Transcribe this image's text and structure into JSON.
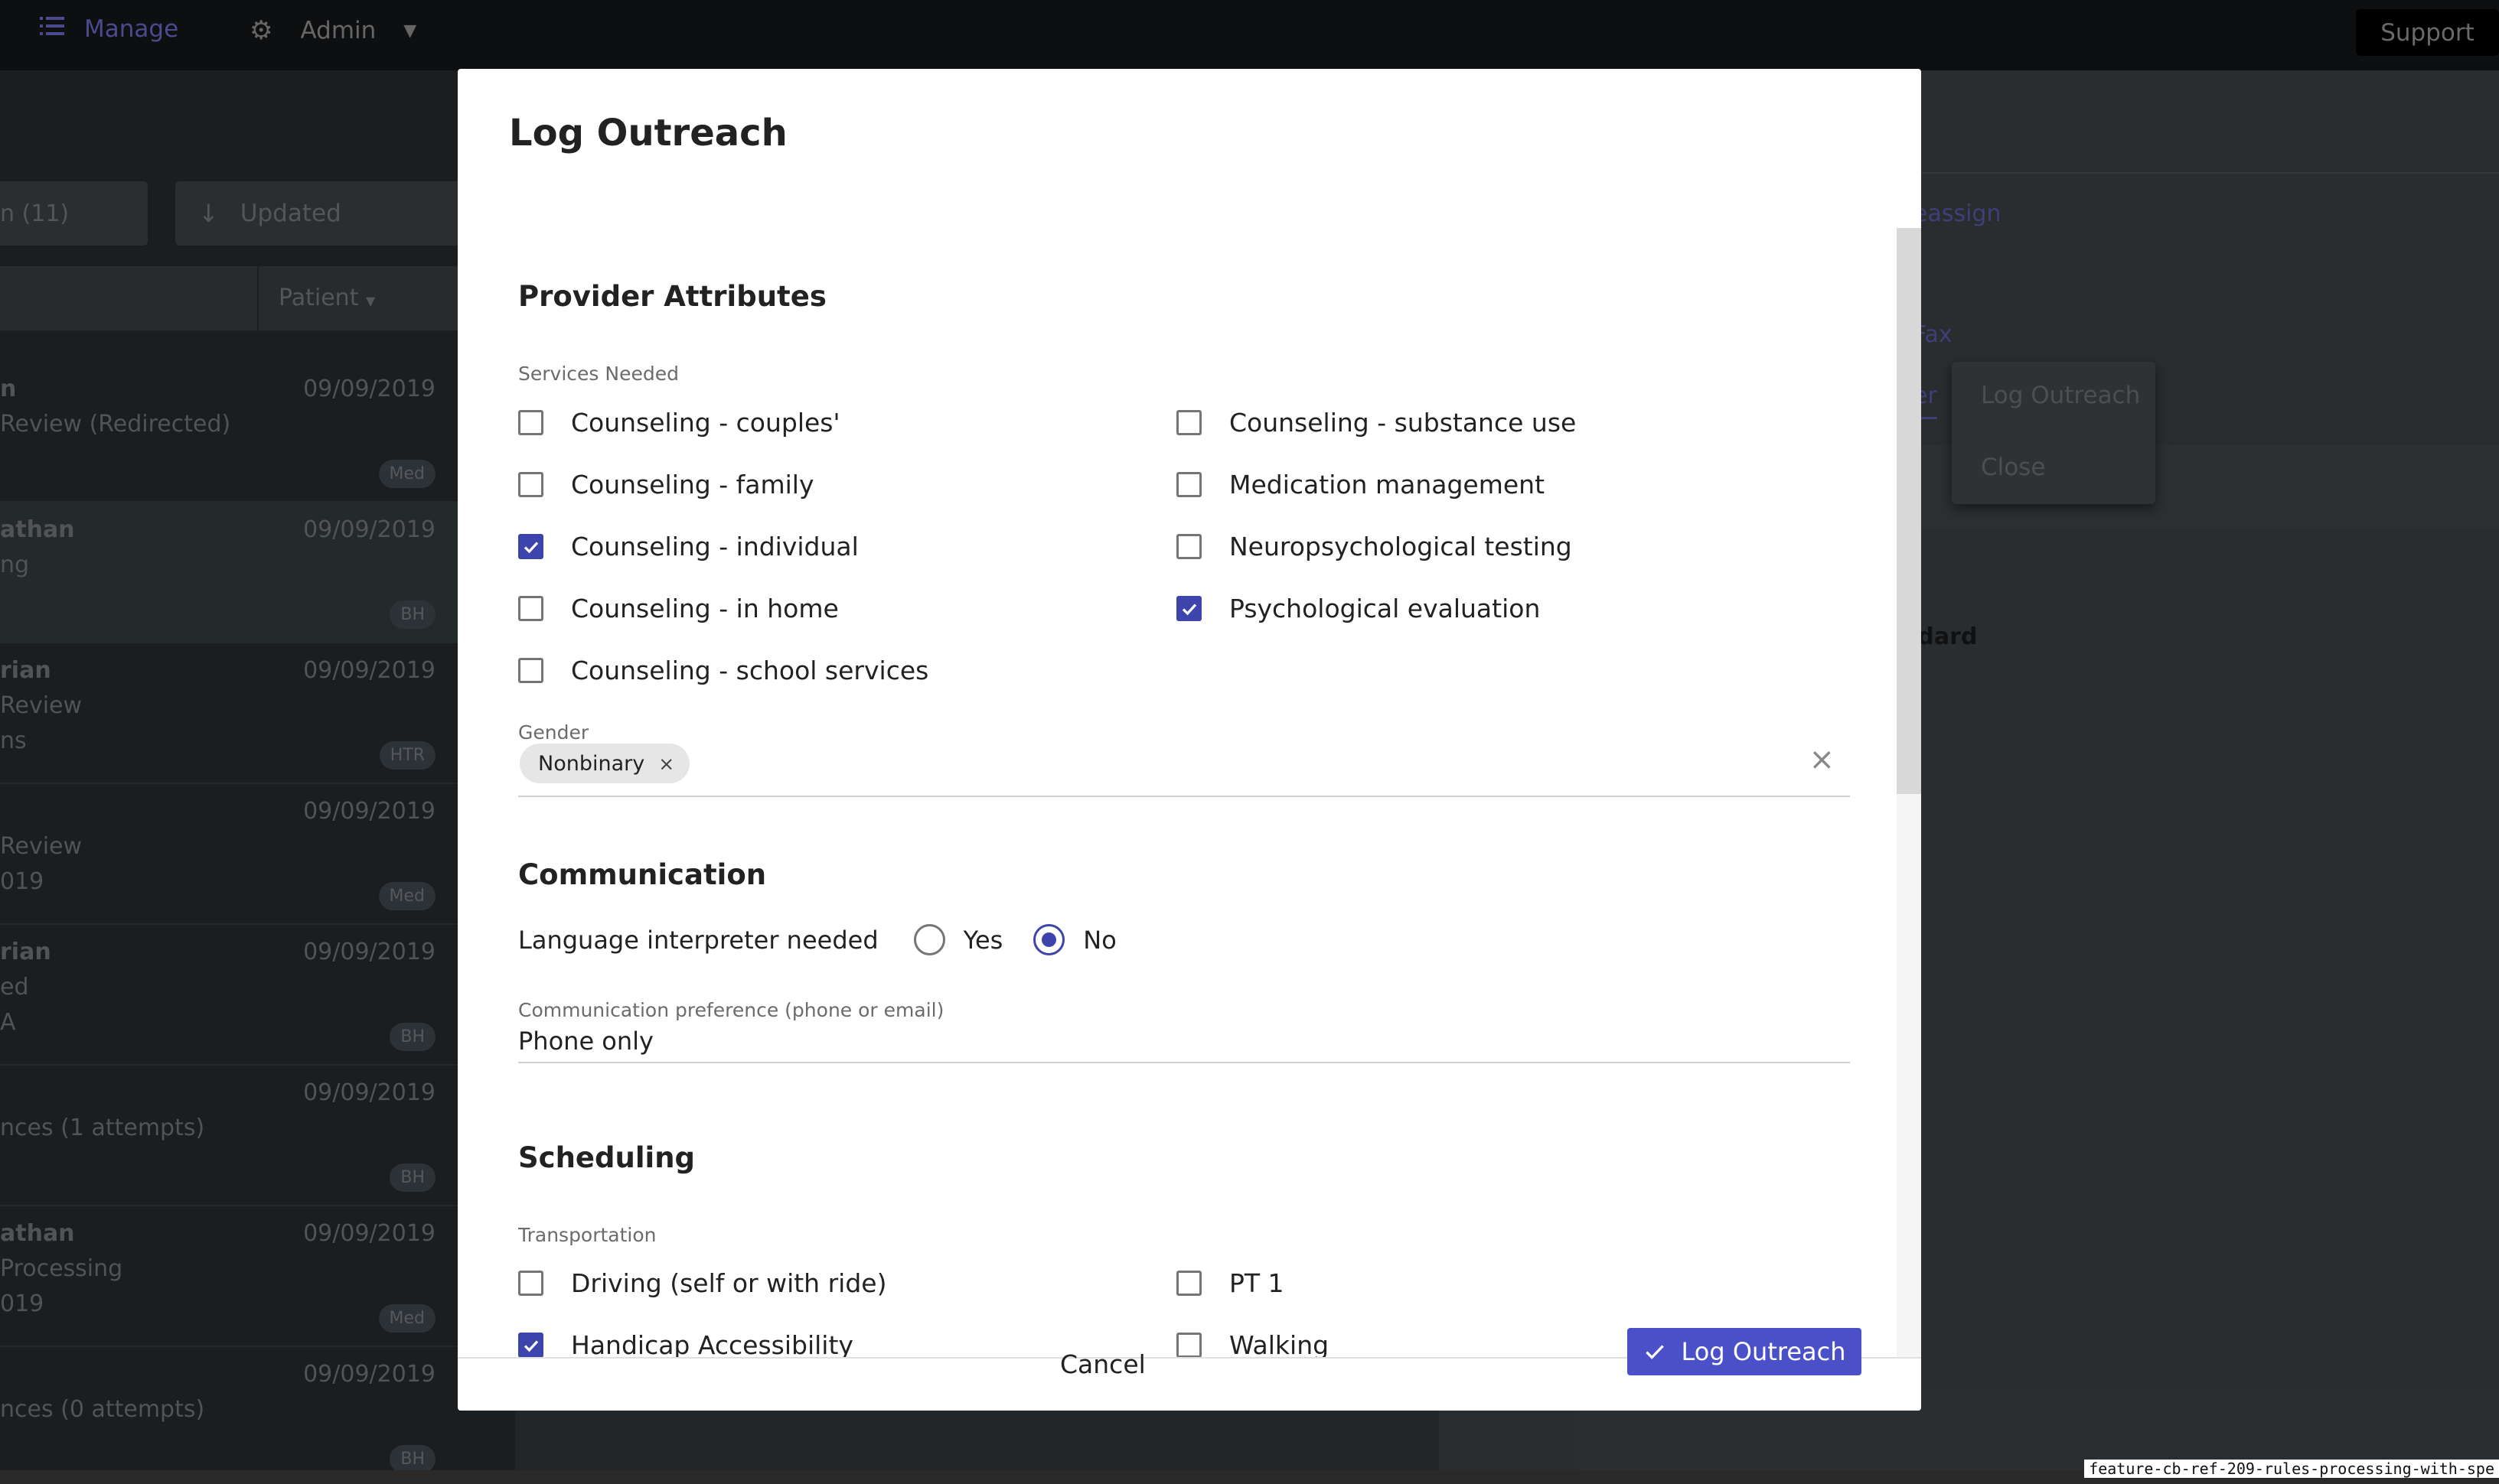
{
  "topbar": {
    "manage_label": "Manage",
    "admin_label": "Admin",
    "support_label": "Support"
  },
  "background": {
    "filter_count_label": "n (11)",
    "sort_label": "Updated",
    "column_patient": "Patient",
    "rows": [
      {
        "l1": "n",
        "l2": "Review (Redirected)",
        "l3": "",
        "date": "09/09/2019",
        "badge": "Med"
      },
      {
        "l1": "athan",
        "l2": "ng",
        "l3": "",
        "date": "09/09/2019",
        "badge": "BH"
      },
      {
        "l1": "rian",
        "l2": "Review",
        "l3": "ns",
        "date": "09/09/2019",
        "badge": "HTR"
      },
      {
        "l1": "",
        "l2": "Review",
        "l3": "019",
        "date": "09/09/2019",
        "badge": "Med"
      },
      {
        "l1": "rian",
        "l2": "ed",
        "l3": "A",
        "date": "09/09/2019",
        "badge": "BH"
      },
      {
        "l1": "",
        "l2": "nces (1 attempts)",
        "l3": "",
        "date": "09/09/2019",
        "badge": "BH"
      },
      {
        "l1": "athan",
        "l2": "Processing",
        "l3": "019",
        "date": "09/09/2019",
        "badge": "Med"
      },
      {
        "l1": "",
        "l2": "nces (0 attempts)",
        "l3": "",
        "date": "09/09/2019",
        "badge": "BH"
      }
    ],
    "reassign_link": "eassign",
    "fax_link": "Fax",
    "tab_fragment": "er",
    "bold_fragment": "ndard",
    "menu_items": [
      "Log Outreach",
      "Close"
    ],
    "branch_name": "feature-cb-ref-209-rules-processing-with-spe"
  },
  "modal": {
    "title": "Log Outreach",
    "provider_attributes": {
      "heading": "Provider Attributes",
      "services_label": "Services Needed",
      "services_left": [
        {
          "label": "Counseling - couples'",
          "checked": false
        },
        {
          "label": "Counseling - family",
          "checked": false
        },
        {
          "label": "Counseling - individual",
          "checked": true
        },
        {
          "label": "Counseling - in home",
          "checked": false
        },
        {
          "label": "Counseling - school services",
          "checked": false
        }
      ],
      "services_right": [
        {
          "label": "Counseling - substance use",
          "checked": false
        },
        {
          "label": "Medication management",
          "checked": false
        },
        {
          "label": "Neuropsychological testing",
          "checked": false
        },
        {
          "label": "Psychological evaluation",
          "checked": true
        }
      ],
      "gender_label": "Gender",
      "gender_chip": "Nonbinary",
      "chip_remove": "×",
      "clear_all": "×"
    },
    "communication": {
      "heading": "Communication",
      "interpreter_label": "Language interpreter needed",
      "option_yes": "Yes",
      "option_no": "No",
      "selected": "No",
      "preference_label": "Communication preference (phone or email)",
      "preference_value": "Phone only"
    },
    "scheduling": {
      "heading": "Scheduling",
      "transport_label": "Transportation",
      "transport_left": [
        {
          "label": "Driving (self or with ride)",
          "checked": false
        },
        {
          "label": "Handicap Accessibility",
          "checked": true
        }
      ],
      "transport_right": [
        {
          "label": "PT 1",
          "checked": false
        },
        {
          "label": "Walking",
          "checked": false
        }
      ]
    },
    "footer": {
      "cancel_label": "Cancel",
      "submit_label": "Log Outreach"
    }
  },
  "colors": {
    "accent": "#3d44ac",
    "primary_button": "#4a50c8",
    "overlay": "#1f2326"
  }
}
